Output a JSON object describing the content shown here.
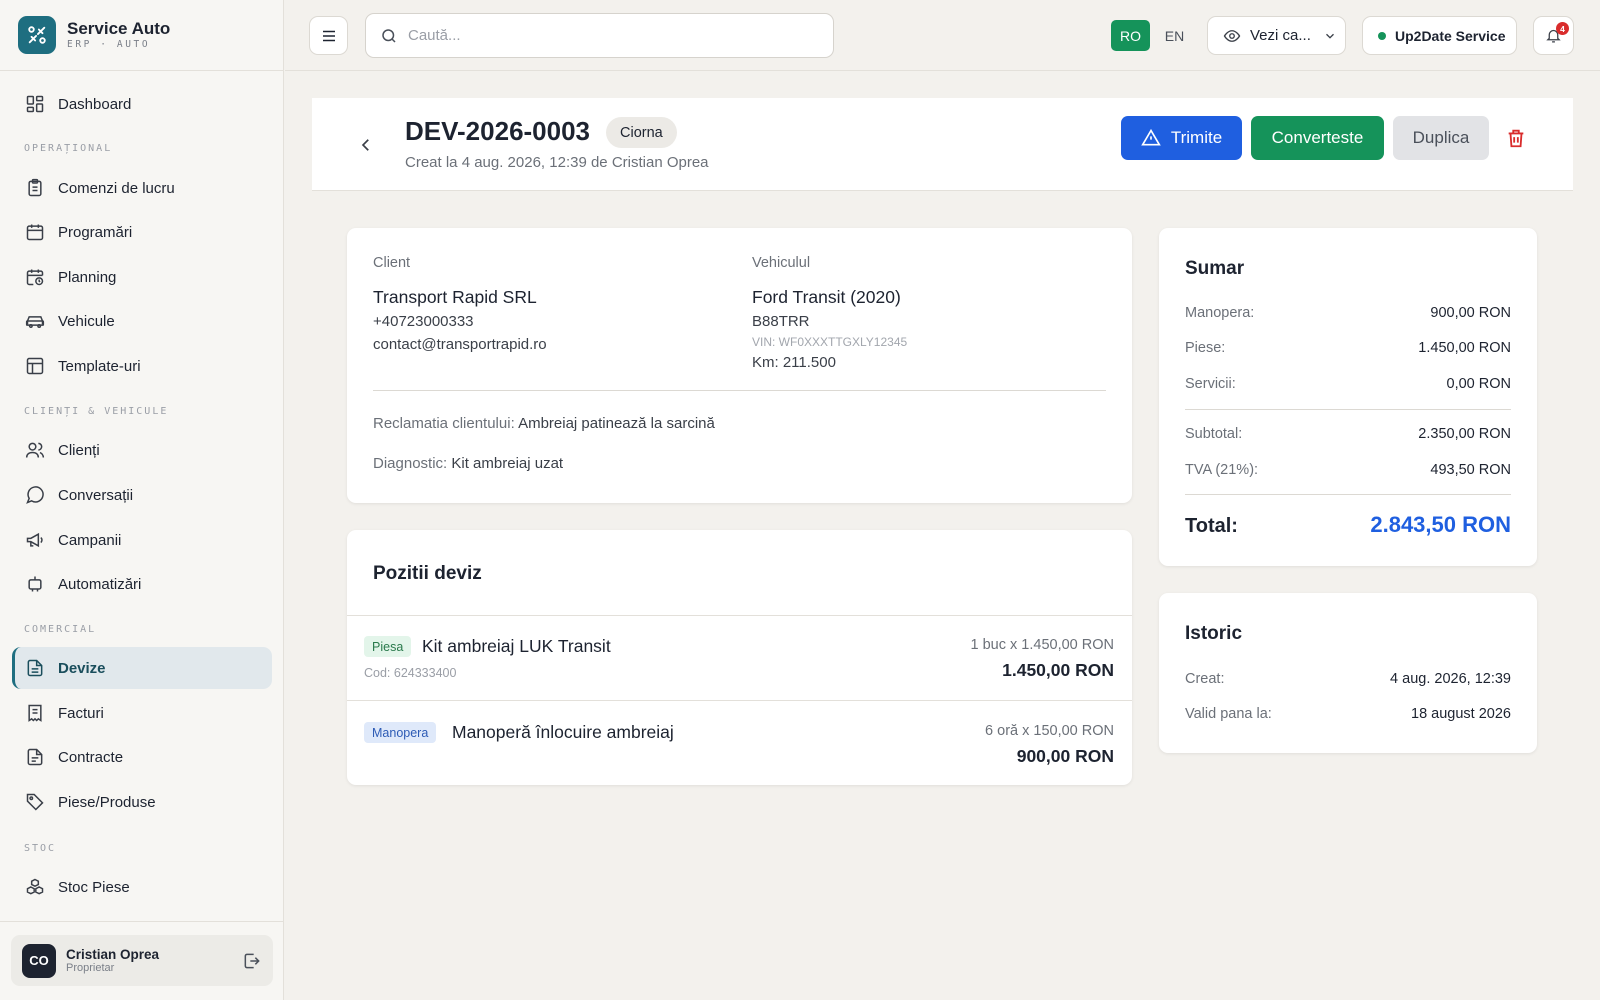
{
  "brand": {
    "title": "Service Auto",
    "subtitle": "ERP · AUTO"
  },
  "sidebar": {
    "dashboard": "Dashboard",
    "sections": {
      "operational": "OPERAȚIONAL",
      "clients": "CLIENȚI & VEHICULE",
      "commercial": "COMERCIAL",
      "stock": "STOC"
    },
    "items": {
      "work_orders": "Comenzi de lucru",
      "appointments": "Programări",
      "planning": "Planning",
      "vehicles": "Vehicule",
      "templates": "Template-uri",
      "clients": "Clienți",
      "conversations": "Conversații",
      "campaigns": "Campanii",
      "automations": "Automatizări",
      "quotes": "Devize",
      "invoices": "Facturi",
      "contracts": "Contracte",
      "parts": "Piese/Produse",
      "stock_parts": "Stoc Piese"
    },
    "active": "quotes",
    "user": {
      "initials": "CO",
      "name": "Cristian Oprea",
      "role": "Proprietar"
    }
  },
  "topbar": {
    "search_placeholder": "Caută...",
    "lang_ro": "RO",
    "lang_en": "EN",
    "view_as": "Vezi ca...",
    "service_name": "Up2Date Service",
    "notifications_count": "4"
  },
  "header": {
    "doc_number": "DEV-2026-0003",
    "status": "Ciorna",
    "created": "Creat la 4 aug. 2026, 12:39 de Cristian Oprea",
    "actions": {
      "send": "Trimite",
      "convert": "Converteste",
      "duplicate": "Duplica"
    }
  },
  "client": {
    "label": "Client",
    "name": "Transport Rapid SRL",
    "phone": "+40723000333",
    "email": "contact@transportrapid.ro"
  },
  "vehicle": {
    "label": "Vehiculul",
    "name": "Ford Transit (2020)",
    "plate": "B88TRR",
    "vin": "VIN: WF0XXXTTGXLY12345",
    "km": "Km: 211.500"
  },
  "complaint": {
    "label": "Reclamatia clientului:",
    "value": "Ambreiaj patinează la sarcină"
  },
  "diagnostic": {
    "label": "Diagnostic:",
    "value": "Kit ambreiaj uzat"
  },
  "items": {
    "title": "Pozitii deviz",
    "rows": [
      {
        "type": "Piesa",
        "name": "Kit ambreiaj LUK Transit",
        "code": "Cod: 624333400",
        "qty": "1 buc x 1.450,00 RON",
        "total": "1.450,00 RON"
      },
      {
        "type": "Manopera",
        "name": "Manoperă înlocuire ambreiaj",
        "qty": "6 oră x 150,00 RON",
        "total": "900,00 RON"
      }
    ]
  },
  "summary": {
    "title": "Sumar",
    "labor_label": "Manopera:",
    "labor": "900,00 RON",
    "parts_label": "Piese:",
    "parts": "1.450,00 RON",
    "services_label": "Servicii:",
    "services": "0,00 RON",
    "subtotal_label": "Subtotal:",
    "subtotal": "2.350,00 RON",
    "vat_label": "TVA (21%):",
    "vat": "493,50 RON",
    "total_label": "Total:",
    "total": "2.843,50 RON"
  },
  "history": {
    "title": "Istoric",
    "created_label": "Creat:",
    "created": "4 aug. 2026, 12:39",
    "valid_label": "Valid pana la:",
    "valid": "18 august 2026"
  },
  "colors": {
    "brand": "#1e6e80",
    "primary": "#1f5fe0",
    "success": "#15935a",
    "danger": "#d92c2c"
  }
}
